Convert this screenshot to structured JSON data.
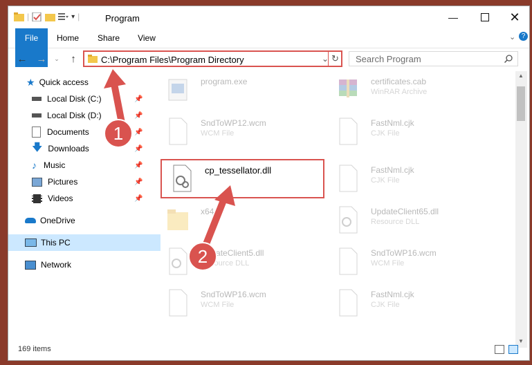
{
  "window": {
    "title": "Program"
  },
  "ribbon": {
    "tabs": [
      "File",
      "Home",
      "Share",
      "View"
    ]
  },
  "address": {
    "path": "C:\\Program Files\\Program Directory"
  },
  "search": {
    "placeholder": "Search Program"
  },
  "sidebar": {
    "items": [
      {
        "label": "Quick access",
        "icon": "star-icon"
      },
      {
        "label": "Local Disk (C:)",
        "icon": "drive-icon",
        "pinned": true
      },
      {
        "label": "Local Disk (D:)",
        "icon": "drive-icon",
        "pinned": true
      },
      {
        "label": "Documents",
        "icon": "documents-icon",
        "pinned": true
      },
      {
        "label": "Downloads",
        "icon": "download-icon",
        "pinned": true
      },
      {
        "label": "Music",
        "icon": "music-icon",
        "pinned": true
      },
      {
        "label": "Pictures",
        "icon": "pictures-icon",
        "pinned": true
      },
      {
        "label": "Videos",
        "icon": "videos-icon",
        "pinned": true
      },
      {
        "label": "OneDrive",
        "icon": "cloud-icon"
      },
      {
        "label": "This PC",
        "icon": "computer-icon",
        "selected": true
      },
      {
        "label": "Network",
        "icon": "network-icon"
      }
    ]
  },
  "files": [
    {
      "name": "program.exe",
      "type": "",
      "icon": "exe-icon"
    },
    {
      "name": "certificates.cab",
      "type": "WinRAR Archive",
      "icon": "archive-icon"
    },
    {
      "name": "SndToWP12.wcm",
      "type": "WCM File",
      "icon": "file-icon"
    },
    {
      "name": "FastNml.cjk",
      "type": "CJK File",
      "icon": "file-icon"
    },
    {
      "name": "cp_tessellator.dll",
      "type": "",
      "icon": "dll-icon"
    },
    {
      "name": "FastNml.cjk",
      "type": "CJK File",
      "icon": "file-icon"
    },
    {
      "name": "x64",
      "type": "",
      "icon": "folder-icon"
    },
    {
      "name": "UpdateClient65.dll",
      "type": "Resource DLL",
      "icon": "dll-icon"
    },
    {
      "name": "UpdateClient5.dll",
      "type": "Resource DLL",
      "icon": "dll-icon"
    },
    {
      "name": "SndToWP16.wcm",
      "type": "WCM File",
      "icon": "file-icon"
    },
    {
      "name": "SndToWP16.wcm",
      "type": "WCM File",
      "icon": "file-icon"
    },
    {
      "name": "FastNml.cjk",
      "type": "CJK File",
      "icon": "file-icon"
    }
  ],
  "status": {
    "items_count": "169 items"
  },
  "annotations": [
    "1",
    "2"
  ],
  "colors": {
    "accent": "#1979ca",
    "highlight": "#d9534f",
    "selected": "#cce8ff"
  }
}
